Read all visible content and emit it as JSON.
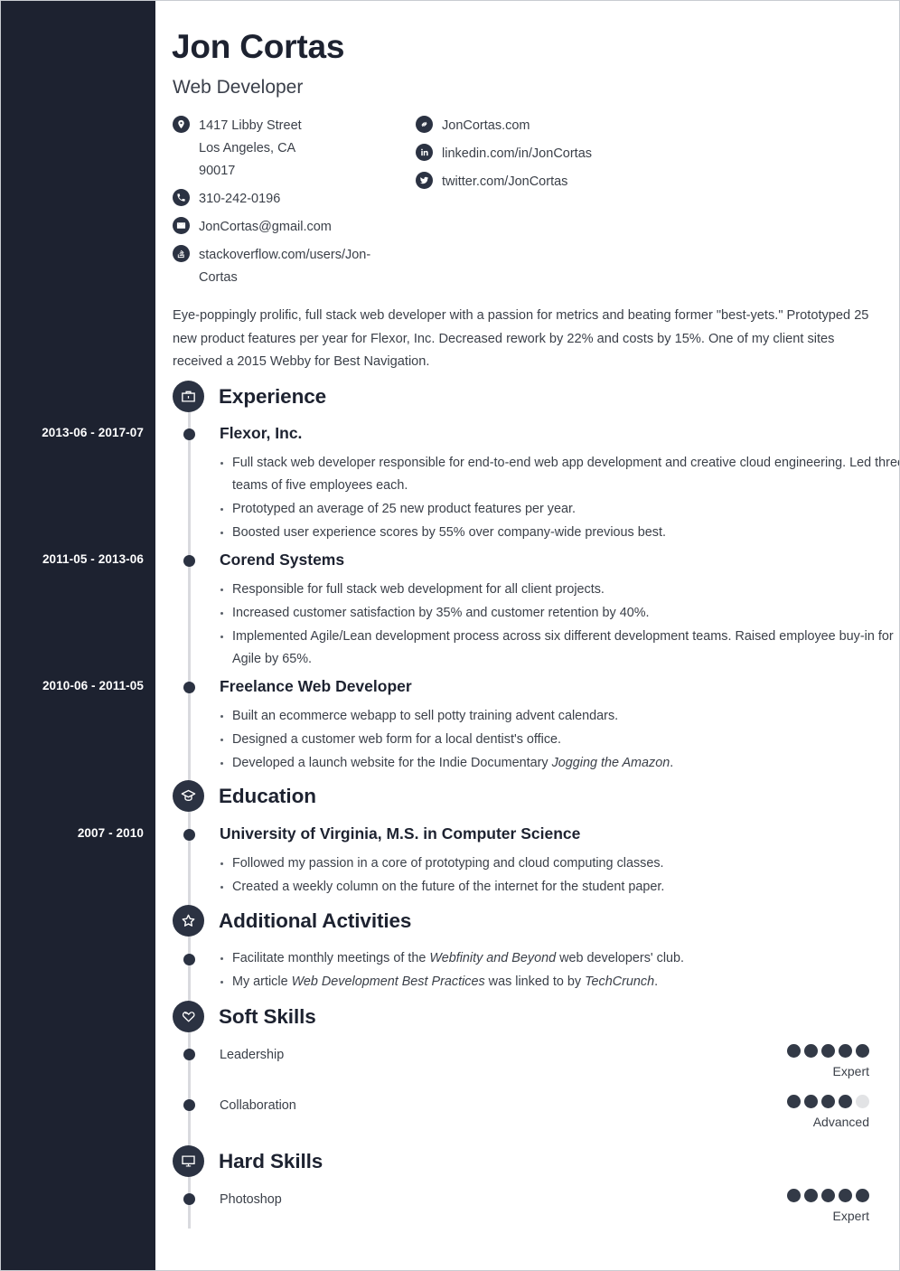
{
  "header": {
    "name": "Jon Cortas",
    "job_title": "Web Developer"
  },
  "contact": {
    "left": [
      {
        "icon": "location-pin-icon",
        "text": "1417 Libby Street Los Angeles, CA 90017"
      },
      {
        "icon": "phone-icon",
        "text": "310-242-0196"
      },
      {
        "icon": "envelope-icon",
        "text": "JonCortas@gmail.com"
      },
      {
        "icon": "stackoverflow-icon",
        "text": "stackoverflow.com/users/Jon-Cortas"
      }
    ],
    "right": [
      {
        "icon": "link-icon",
        "text": "JonCortas.com"
      },
      {
        "icon": "linkedin-icon",
        "text": "linkedin.com/in/JonCortas"
      },
      {
        "icon": "twitter-icon",
        "text": "twitter.com/JonCortas"
      }
    ]
  },
  "summary": "Eye-poppingly prolific, full stack web developer with a passion for metrics and beating former \"best-yets.\" Prototyped 25 new product features per year for Flexor, Inc. Decreased rework by 22% and costs by 15%. One of my client sites received a 2015 Webby for Best Navigation.",
  "sections": {
    "experience": {
      "title": "Experience",
      "icon": "briefcase-icon",
      "entries": [
        {
          "date": "2013-06 - 2017-07",
          "title": "Flexor, Inc.",
          "bullets": [
            "Full stack web developer responsible for end-to-end web app development and creative cloud engineering. Led three teams of five employees each.",
            "Prototyped an average of 25 new product features per year.",
            "Boosted user experience scores by 55% over company-wide previous best."
          ]
        },
        {
          "date": "2011-05 - 2013-06",
          "title": "Corend Systems",
          "bullets": [
            "Responsible for full stack web development for all client projects.",
            "Increased customer satisfaction by 35% and customer retention by 40%.",
            "Implemented Agile/Lean development process across six different development teams. Raised employee buy-in for Agile by 65%."
          ]
        },
        {
          "date": "2010-06 - 2011-05",
          "title": "Freelance Web Developer",
          "bullets": [
            "Built an ecommerce webapp to sell potty training advent calendars.",
            "Designed a customer web form for a local dentist's office.",
            "Developed a launch website for the Indie Documentary <i>Jogging the Amazon</i>."
          ]
        }
      ]
    },
    "education": {
      "title": "Education",
      "icon": "graduation-cap-icon",
      "entries": [
        {
          "date": "2007 - 2010",
          "title": "University of Virginia, M.S. in Computer Science",
          "bullets": [
            "Followed my passion in a core of prototyping and cloud computing classes.",
            "Created a weekly column on the future of the internet for the student paper."
          ]
        }
      ]
    },
    "activities": {
      "title": "Additional Activities",
      "icon": "star-icon",
      "bullets": [
        "Facilitate monthly meetings of the <i>Webfinity and Beyond</i> web developers' club.",
        "My article <i>Web Development Best Practices</i> was linked to by <i>TechCrunch</i>."
      ]
    },
    "soft_skills": {
      "title": "Soft Skills",
      "icon": "heart-in-hand-icon",
      "skills": [
        {
          "name": "Leadership",
          "level": 5,
          "max": 5,
          "label": "Expert"
        },
        {
          "name": "Collaboration",
          "level": 4,
          "max": 5,
          "label": "Advanced"
        }
      ]
    },
    "hard_skills": {
      "title": "Hard Skills",
      "icon": "monitor-icon",
      "skills": [
        {
          "name": "Photoshop",
          "level": 5,
          "max": 5,
          "label": "Expert"
        }
      ]
    }
  },
  "colors": {
    "sidebar": "#1d2230",
    "accent": "#2b3242",
    "body_text": "#3b4049",
    "dot_filled": "#333a47",
    "dot_empty": "#e2e3e5",
    "rail": "#d9dade"
  }
}
